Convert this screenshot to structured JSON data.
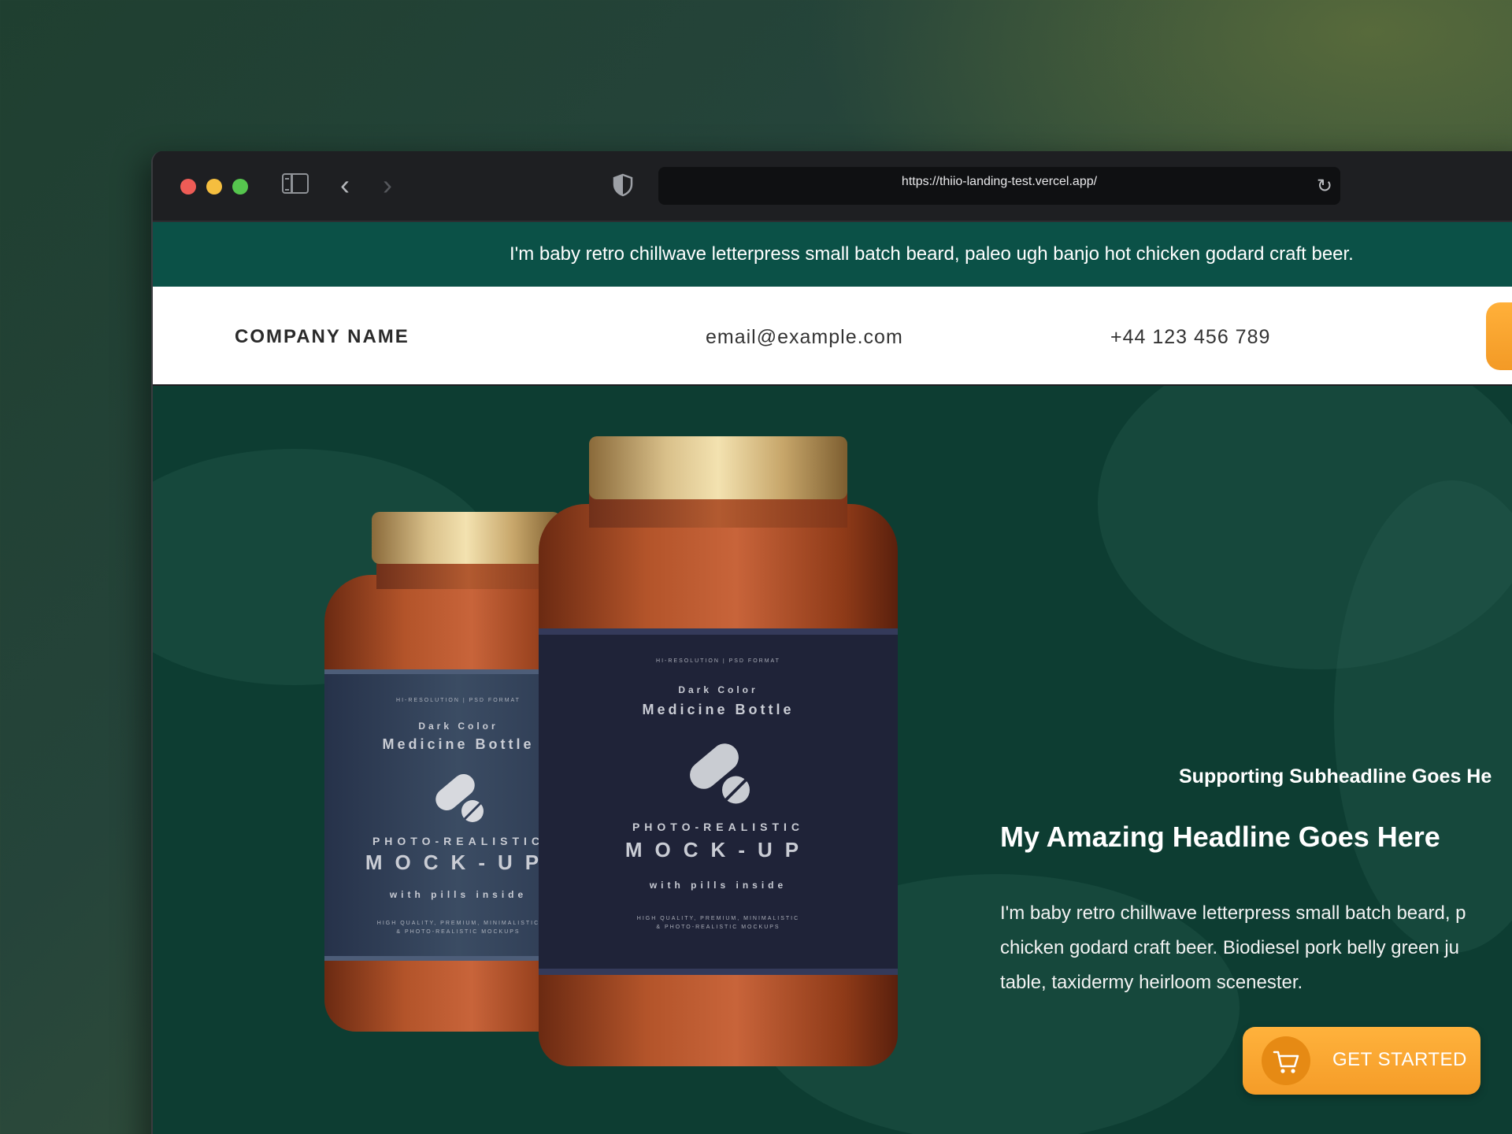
{
  "browser": {
    "url": "https://thiio-landing-test.vercel.app/"
  },
  "announcement": {
    "text": "I'm baby retro chillwave letterpress small batch beard, paleo ugh banjo hot chicken godard craft beer."
  },
  "header": {
    "company": "COMPANY NAME",
    "email": "email@example.com",
    "phone": "+44 123 456 789"
  },
  "hero": {
    "subheadline": "Supporting Subheadline Goes He",
    "headline": "My Amazing Headline Goes Here",
    "body_lines": [
      "I'm baby retro chillwave letterpress small batch beard, p",
      "chicken godard craft beer. Biodiesel pork belly green ju",
      "table, taxidermy heirloom scenester."
    ],
    "cta_label": "GET STARTED"
  },
  "product_labels": {
    "back": {
      "top": "HI-RESOLUTION  |  PSD FORMAT",
      "line1": "Dark Color",
      "line2": "Medicine Bottle",
      "line3": "PHOTO-REALISTIC",
      "line4": "MOCK-UP",
      "line5": "with pills inside",
      "footer1": "HIGH QUALITY, PREMIUM, MINIMALISTIC",
      "footer2": "& PHOTO-REALISTIC MOCKUPS"
    },
    "front": {
      "top": "HI-RESOLUTION  |  PSD FORMAT",
      "line1": "Dark Color",
      "line2": "Medicine Bottle",
      "line3": "PHOTO-REALISTIC",
      "line4": "MOCK-UP",
      "line5": "with pills inside",
      "footer1": "HIGH QUALITY, PREMIUM, MINIMALISTIC",
      "footer2": "& PHOTO-REALISTIC MOCKUPS"
    }
  },
  "icons": {
    "sidebar": "sidebar-toggle-icon",
    "back": "chevron-left-icon",
    "forward": "chevron-right-icon",
    "privacy": "shield-icon",
    "reload": "reload-icon",
    "cart": "cart-icon"
  },
  "colors": {
    "announcement_bg": "#0b5147",
    "hero_bg": "#0d3d32",
    "cta": "#f7a42e"
  }
}
